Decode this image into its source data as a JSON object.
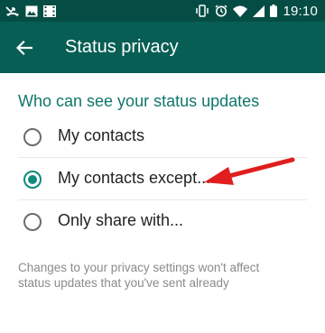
{
  "status_bar": {
    "time": "19:10",
    "left_icons": [
      "missed-call-icon",
      "image-icon",
      "video-icon"
    ],
    "right_icons": [
      "vibrate-icon",
      "alarm-icon",
      "wifi-icon",
      "signal-icon",
      "battery-icon"
    ]
  },
  "app_bar": {
    "title": "Status privacy",
    "back_icon": "arrow-back-icon"
  },
  "section": {
    "header": "Who can see your status updates"
  },
  "options": [
    {
      "label": "My contacts",
      "selected": false
    },
    {
      "label": "My contacts except...",
      "selected": true
    },
    {
      "label": "Only share with...",
      "selected": false
    }
  ],
  "footer": {
    "note": "Changes to your privacy settings won't affect status updates that you've sent already"
  },
  "colors": {
    "status_bar": "#054d44",
    "app_bar": "#075e54",
    "accent": "#0f8a7d",
    "header_text": "#10766b",
    "annotation_arrow": "#e01e1e"
  }
}
